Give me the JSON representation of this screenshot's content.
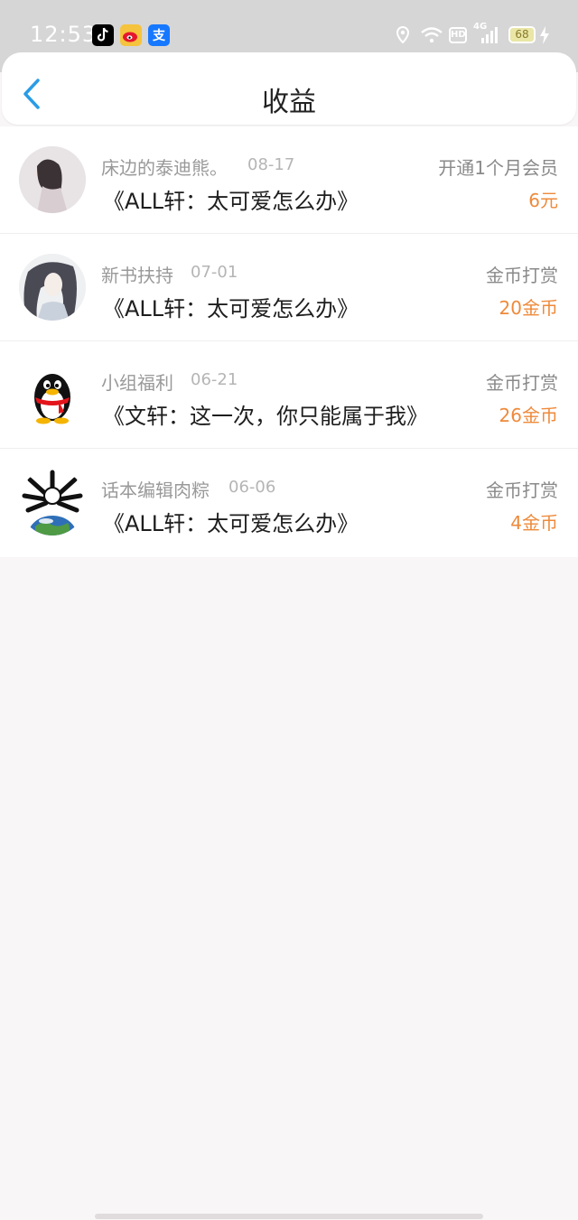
{
  "status_bar": {
    "time": "12:53",
    "apps": [
      {
        "icon": "tiktok-icon",
        "color": "#000000"
      },
      {
        "icon": "weibo-icon",
        "color": "#f5c33d"
      },
      {
        "icon": "alipay-icon",
        "color": "#1678ff",
        "glyph": "支"
      }
    ],
    "hd": "HD",
    "network": "4G",
    "battery": "68"
  },
  "header": {
    "title": "收益"
  },
  "earnings": [
    {
      "name": "床边的泰迪熊。",
      "date": "08-17",
      "book": "《ALL轩：太可爱怎么办》",
      "type": "开通1个月会员",
      "amount": "6元",
      "avatar": "girl-portrait-avatar"
    },
    {
      "name": "新书扶持",
      "date": "07-01",
      "book": "《ALL轩：太可爱怎么办》",
      "type": "金币打赏",
      "amount": "20金币",
      "avatar": "anime-character-avatar"
    },
    {
      "name": "小组福利",
      "date": "06-21",
      "book": "《文轩：这一次，你只能属于我》",
      "type": "金币打赏",
      "amount": "26金币",
      "avatar": "qq-penguin-avatar"
    },
    {
      "name": "话本编辑肉粽",
      "date": "06-06",
      "book": "《ALL轩：太可爱怎么办》",
      "type": "金币打赏",
      "amount": "4金币",
      "avatar": "earth-skull-avatar"
    }
  ],
  "colors": {
    "accent": "#2a9ce6",
    "amount": "#ee8a3b",
    "background": "#f8f6f7"
  }
}
